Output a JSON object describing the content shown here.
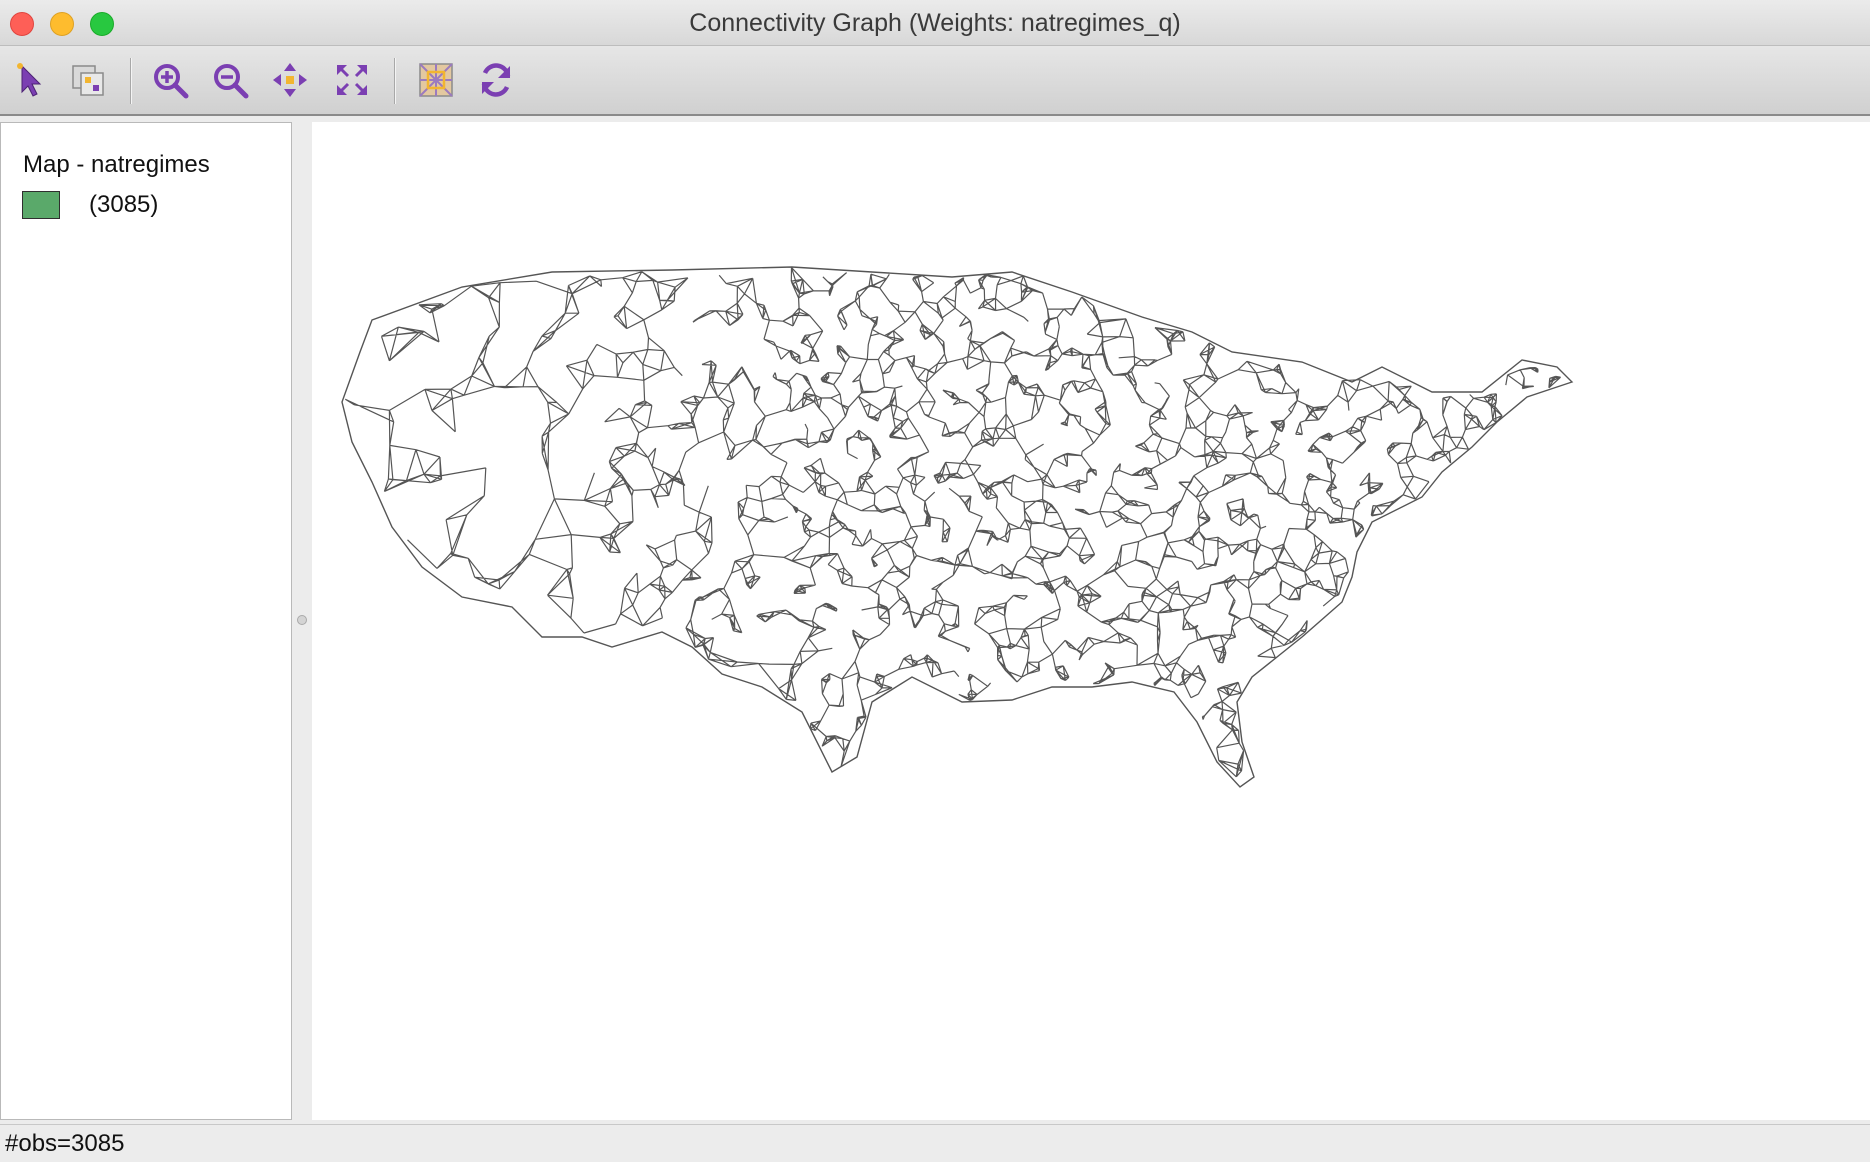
{
  "window": {
    "title": "Connectivity Graph (Weights: natregimes_q)"
  },
  "toolbar": {
    "tools": [
      {
        "name": "select-tool",
        "icon": "arrow-pointer-icon"
      },
      {
        "name": "selection-copy-tool",
        "icon": "copy-selection-icon"
      },
      {
        "name": "zoom-in-tool",
        "icon": "zoom-in-icon"
      },
      {
        "name": "zoom-out-tool",
        "icon": "zoom-out-icon"
      },
      {
        "name": "pan-tool",
        "icon": "pan-arrows-icon"
      },
      {
        "name": "fit-to-window-tool",
        "icon": "expand-icon"
      },
      {
        "name": "show-hide-map-tool",
        "icon": "map-toggle-icon"
      },
      {
        "name": "refresh-tool",
        "icon": "refresh-icon"
      }
    ],
    "accent_color": "#7b3fb2"
  },
  "legend": {
    "title": "Map - natregimes",
    "items": [
      {
        "label": "(3085)",
        "color": "#5aa96a"
      }
    ]
  },
  "map": {
    "edge_color": "#555555",
    "background": "#ffffff"
  },
  "status": {
    "text": "#obs=3085"
  }
}
